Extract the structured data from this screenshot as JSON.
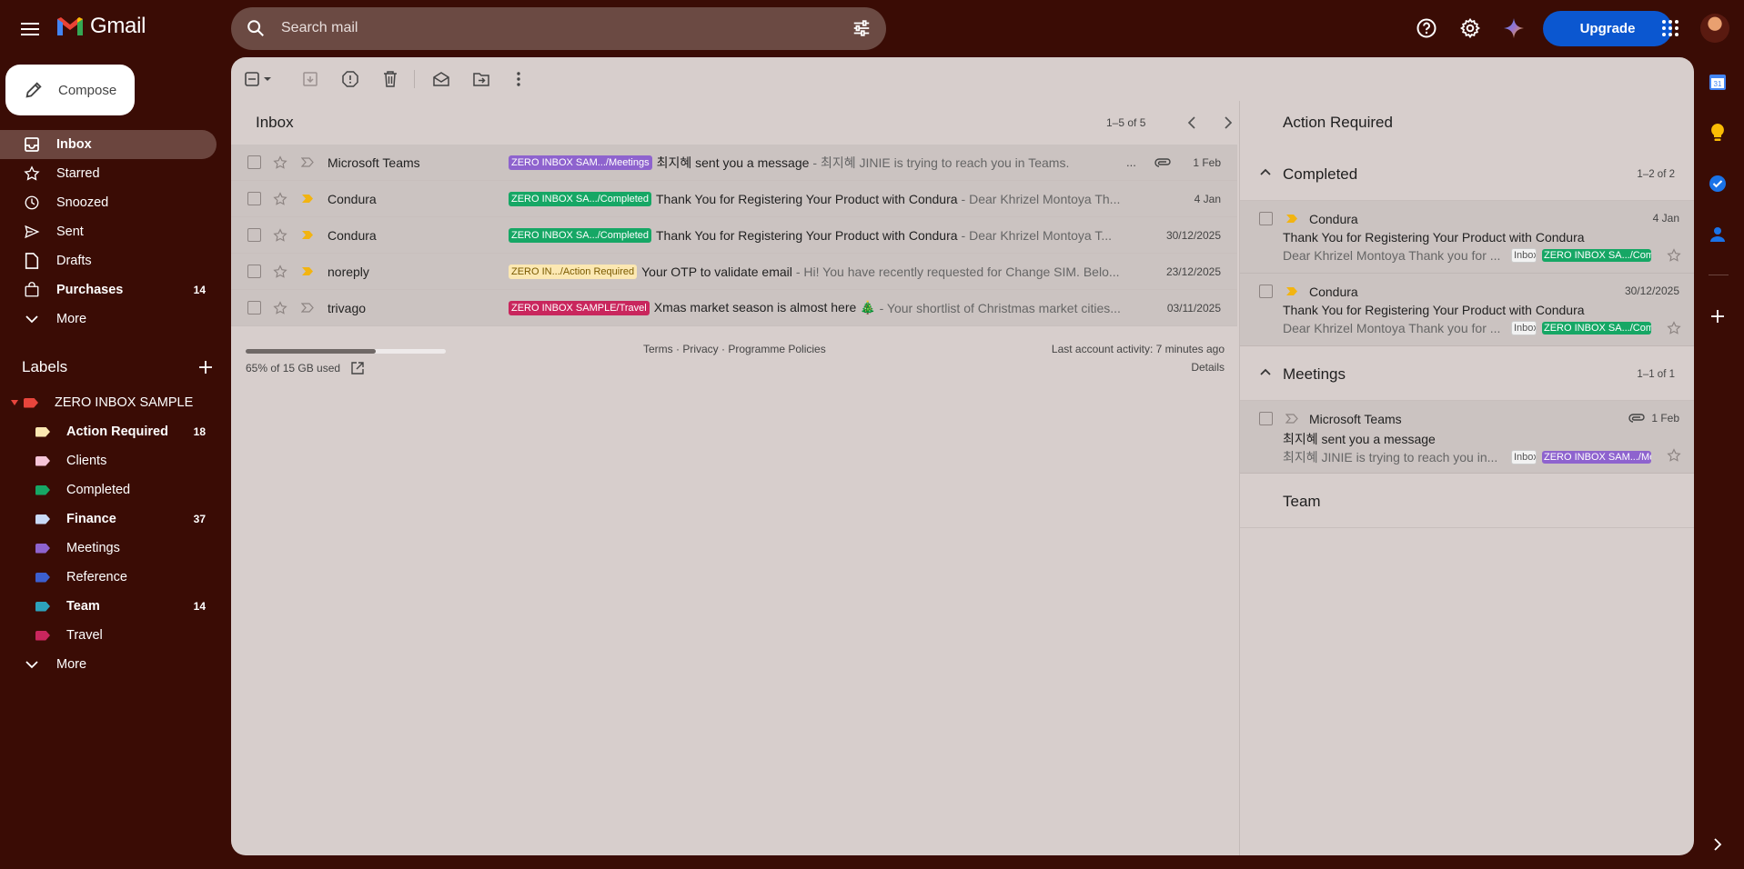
{
  "header": {
    "app_name": "Gmail",
    "search_placeholder": "Search mail",
    "upgrade_label": "Upgrade"
  },
  "compose_label": "Compose",
  "nav": [
    {
      "label": "Inbox",
      "icon": "inbox-icon",
      "active": true,
      "count": ""
    },
    {
      "label": "Starred",
      "icon": "star-icon",
      "count": ""
    },
    {
      "label": "Snoozed",
      "icon": "clock-icon",
      "count": ""
    },
    {
      "label": "Sent",
      "icon": "send-icon",
      "count": ""
    },
    {
      "label": "Drafts",
      "icon": "draft-icon",
      "count": ""
    },
    {
      "label": "Purchases",
      "icon": "purchases-icon",
      "bold": true,
      "count": "14"
    },
    {
      "label": "More",
      "icon": "chevron-down-icon",
      "count": ""
    }
  ],
  "labels_heading": "Labels",
  "labels": [
    {
      "label": "ZERO INBOX SAMPLE",
      "color": "#e8453c",
      "indent": 0,
      "count": ""
    },
    {
      "label": "Action Required",
      "color": "#fce8b2",
      "indent": 1,
      "bold": true,
      "count": "18"
    },
    {
      "label": "Clients",
      "color": "#f6c5d8",
      "indent": 1,
      "count": ""
    },
    {
      "label": "Completed",
      "color": "#16a765",
      "indent": 1,
      "count": ""
    },
    {
      "label": "Finance",
      "color": "#c9daf8",
      "indent": 1,
      "bold": true,
      "count": "37"
    },
    {
      "label": "Meetings",
      "color": "#8e63ce",
      "indent": 1,
      "count": ""
    },
    {
      "label": "Reference",
      "color": "#3c5fd0",
      "indent": 1,
      "count": ""
    },
    {
      "label": "Team",
      "color": "#2da2bb",
      "indent": 1,
      "bold": true,
      "count": "14"
    },
    {
      "label": "Travel",
      "color": "#c9265d",
      "indent": 1,
      "count": ""
    },
    {
      "label": "More",
      "icon": "chevron-down-icon",
      "indent": 0,
      "count": ""
    }
  ],
  "inbox": {
    "title": "Inbox",
    "pager": "1–5 of 5"
  },
  "emails": [
    {
      "sender": "Microsoft Teams",
      "chip": "ZERO INBOX SAM.../Meetings",
      "chip_bg": "#8e63ce",
      "chip_fg": "#ffffff",
      "subject": "최지혜 sent you a message",
      "snippet": "- 최지혜 JINIE is trying to reach you in Teams.",
      "date": "1 Feb",
      "important": false,
      "attachment": true
    },
    {
      "sender": "Condura",
      "chip": "ZERO INBOX SA.../Completed",
      "chip_bg": "#16a765",
      "chip_fg": "#ffffff",
      "subject": "Thank You for Registering Your Product with Condura",
      "snippet": "- Dear Khrizel Montoya Th...",
      "date": "4 Jan",
      "important": true
    },
    {
      "sender": "Condura",
      "chip": "ZERO INBOX SA.../Completed",
      "chip_bg": "#16a765",
      "chip_fg": "#ffffff",
      "subject": "Thank You for Registering Your Product with Condura",
      "snippet": "- Dear Khrizel Montoya T...",
      "date": "30/12/2025",
      "important": true
    },
    {
      "sender": "noreply",
      "chip": "ZERO IN.../Action Required",
      "chip_bg": "#fce8b2",
      "chip_fg": "#7a5a00",
      "subject": "Your OTP to validate email",
      "snippet": "- Hi! You have recently requested for Change SIM. Belo...",
      "date": "23/12/2025",
      "important": true
    },
    {
      "sender": "trivago",
      "chip": "ZERO INBOX SAMPLE/Travel",
      "chip_bg": "#c9265d",
      "chip_fg": "#ffffff",
      "subject": "Xmas market season is almost here 🎄",
      "snippet": "- Your shortlist of Christmas market cities...",
      "date": "03/11/2025",
      "important": false
    }
  ],
  "footer": {
    "storage": "65% of 15 GB used",
    "storage_fraction": 0.65,
    "links": "Terms · Privacy · Programme Policies",
    "activity": "Last account activity: 7 minutes ago",
    "details": "Details"
  },
  "pane": {
    "title": "Action Required",
    "sections": [
      {
        "title": "Completed",
        "count": "1–2 of 2",
        "items": [
          {
            "sender": "Condura",
            "date": "4 Jan",
            "subject": "Thank You for Registering Your Product with Condura",
            "snippet": "Dear Khrizel Montoya Thank you for ...",
            "inbox_chip": "Inbox",
            "chip": "ZERO INBOX SA.../Completed",
            "chip_bg": "#16a765",
            "important": true
          },
          {
            "sender": "Condura",
            "date": "30/12/2025",
            "subject": "Thank You for Registering Your Product with Condura",
            "snippet": "Dear Khrizel Montoya Thank you for ...",
            "inbox_chip": "Inbox",
            "chip": "ZERO INBOX SA.../Completed",
            "chip_bg": "#16a765",
            "important": true
          }
        ]
      },
      {
        "title": "Meetings",
        "count": "1–1 of 1",
        "items": [
          {
            "sender": "Microsoft Teams",
            "date": "1 Feb",
            "subject": "최지혜 sent you a message",
            "snippet": "최지혜 JINIE is trying to reach you in...",
            "inbox_chip": "Inbox",
            "chip": "ZERO INBOX SAM.../Meetings",
            "chip_bg": "#8e63ce",
            "important": false,
            "attachment": true
          }
        ]
      },
      {
        "title": "Team",
        "count": "",
        "items": []
      }
    ]
  }
}
